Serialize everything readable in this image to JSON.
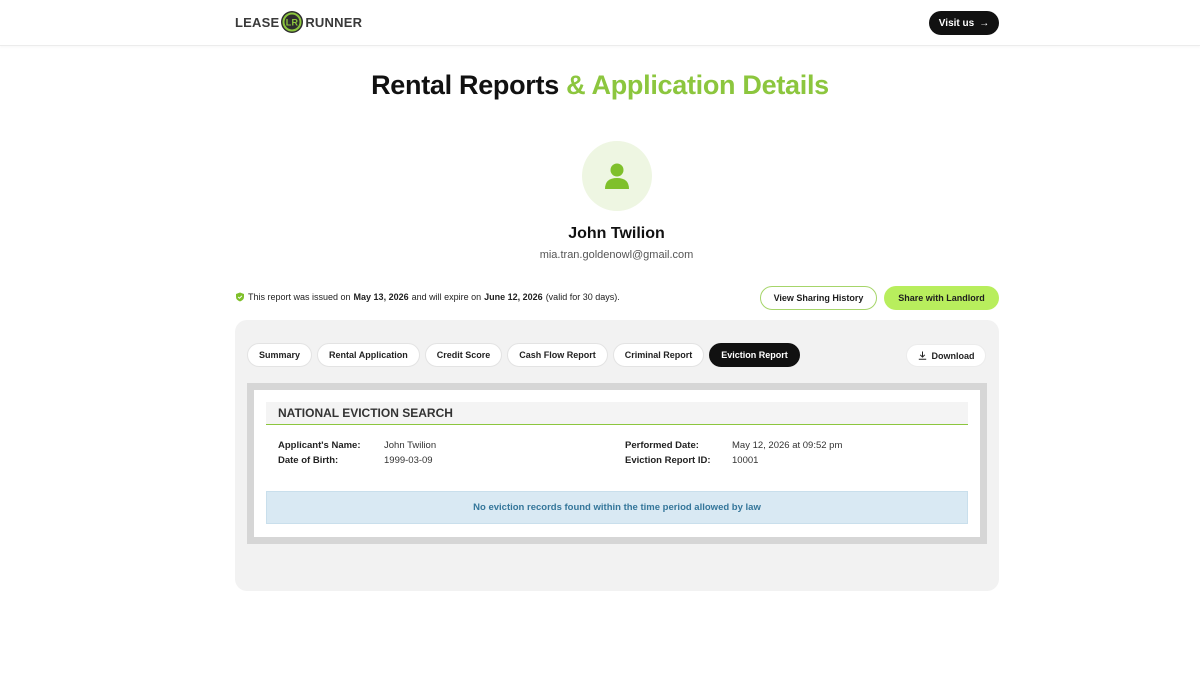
{
  "header": {
    "logo_left": "LEASE",
    "logo_right": "RUNNER",
    "visit_label": "Visit us"
  },
  "title": {
    "part1": "Rental Reports",
    "part2": "& Application Details"
  },
  "profile": {
    "name": "John Twilion",
    "email": "mia.tran.goldenowl@gmail.com"
  },
  "notice": {
    "prefix": "This report was issued on",
    "issued_date": "May 13, 2026",
    "middle": "and will expire on",
    "expire_date": "June 12, 2026",
    "suffix": "(valid for 30 days)."
  },
  "actions": {
    "history_label": "View Sharing History",
    "share_label": "Share with Landlord"
  },
  "tabs": [
    {
      "label": "Summary",
      "active": false
    },
    {
      "label": "Rental Application",
      "active": false
    },
    {
      "label": "Credit Score",
      "active": false
    },
    {
      "label": "Cash Flow Report",
      "active": false
    },
    {
      "label": "Criminal Report",
      "active": false
    },
    {
      "label": "Eviction Report",
      "active": true
    }
  ],
  "download_label": "Download",
  "report": {
    "heading": "NATIONAL EVICTION SEARCH",
    "applicant_label": "Applicant's Name:",
    "applicant_value": "John Twilion",
    "dob_label": "Date of Birth:",
    "dob_value": "1999-03-09",
    "performed_label": "Performed Date:",
    "performed_value": "May 12, 2026 at 09:52 pm",
    "report_id_label": "Eviction Report ID:",
    "report_id_value": "10001",
    "no_records": "No eviction records found within the time period allowed by law"
  },
  "colors": {
    "brand_green": "#8cc63e",
    "button_green": "#b8ee5d",
    "dark": "#111111",
    "info_bg": "#d9e9f3",
    "info_text": "#34769a"
  },
  "icons": [
    "lease-runner-logo-mark",
    "arrow-right-icon",
    "user-icon",
    "shield-check-icon",
    "download-icon"
  ]
}
